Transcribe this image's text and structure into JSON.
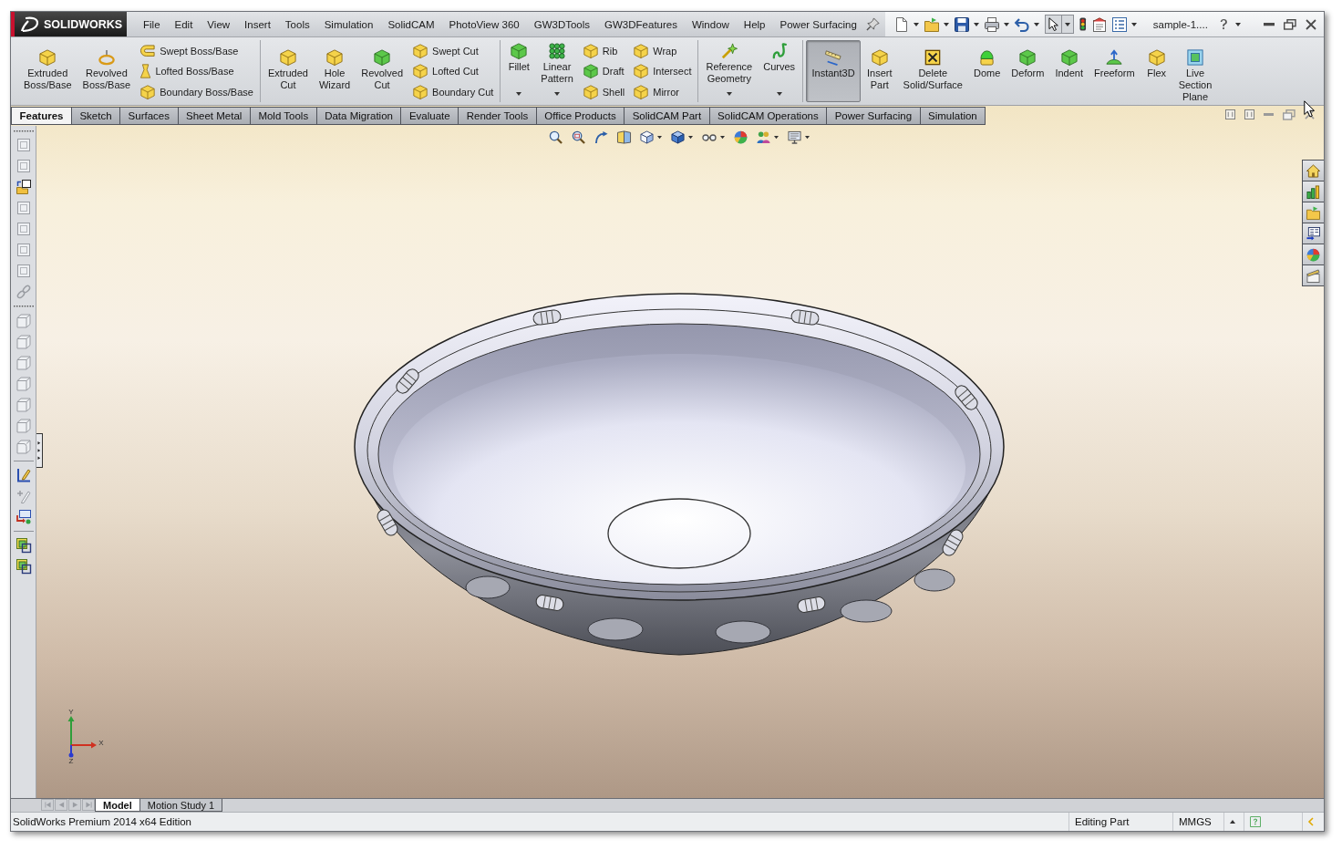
{
  "window": {
    "logo_text": "SOLIDWORKS"
  },
  "menu": [
    "File",
    "Edit",
    "View",
    "Insert",
    "Tools",
    "Simulation",
    "SolidCAM",
    "PhotoView 360",
    "GW3DTools",
    "GW3DFeatures",
    "Window",
    "Help",
    "Power Surfacing"
  ],
  "quick_access": {
    "document_name": "sample-1...."
  },
  "ribbon": {
    "groups": [
      {
        "items": [
          {
            "kind": "large",
            "label": "Extruded\nBoss/Base",
            "pressed": false,
            "dropdown": false
          },
          {
            "kind": "large",
            "label": "Revolved\nBoss/Base",
            "pressed": false,
            "dropdown": false
          },
          {
            "kind": "stack",
            "buttons": [
              "Swept Boss/Base",
              "Lofted Boss/Base",
              "Boundary Boss/Base"
            ]
          }
        ]
      },
      {
        "items": [
          {
            "kind": "large",
            "label": "Extruded\nCut",
            "pressed": false,
            "dropdown": false
          },
          {
            "kind": "large",
            "label": "Hole\nWizard",
            "pressed": false,
            "dropdown": false
          },
          {
            "kind": "large",
            "label": "Revolved\nCut",
            "pressed": false,
            "dropdown": false
          },
          {
            "kind": "stack",
            "buttons": [
              "Swept Cut",
              "Lofted Cut",
              "Boundary Cut"
            ]
          }
        ]
      },
      {
        "items": [
          {
            "kind": "large",
            "label": "Fillet",
            "pressed": false,
            "dropdown": true
          },
          {
            "kind": "large",
            "label": "Linear\nPattern",
            "pressed": false,
            "dropdown": true
          },
          {
            "kind": "stack",
            "buttons": [
              "Rib",
              "Draft",
              "Shell"
            ]
          },
          {
            "kind": "stack",
            "buttons": [
              "Wrap",
              "Intersect",
              "Mirror"
            ]
          }
        ]
      },
      {
        "items": [
          {
            "kind": "large",
            "label": "Reference\nGeometry",
            "pressed": false,
            "dropdown": true
          },
          {
            "kind": "large",
            "label": "Curves",
            "pressed": false,
            "dropdown": true
          }
        ]
      },
      {
        "items": [
          {
            "kind": "large",
            "label": "Instant3D",
            "pressed": true,
            "dropdown": false
          },
          {
            "kind": "large",
            "label": "Insert\nPart",
            "pressed": false,
            "dropdown": false
          },
          {
            "kind": "large",
            "label": "Delete\nSolid/Surface",
            "pressed": false,
            "dropdown": false
          },
          {
            "kind": "large",
            "label": "Dome",
            "pressed": false,
            "dropdown": false
          },
          {
            "kind": "large",
            "label": "Deform",
            "pressed": false,
            "dropdown": false
          },
          {
            "kind": "large",
            "label": "Indent",
            "pressed": false,
            "dropdown": false
          },
          {
            "kind": "large",
            "label": "Freeform",
            "pressed": false,
            "dropdown": false
          },
          {
            "kind": "large",
            "label": "Flex",
            "pressed": false,
            "dropdown": false
          },
          {
            "kind": "large",
            "label": "Live\nSection\nPlane",
            "pressed": false,
            "dropdown": false
          }
        ]
      }
    ]
  },
  "tabs": [
    {
      "label": "Features",
      "selected": true
    },
    {
      "label": "Sketch",
      "selected": false
    },
    {
      "label": "Surfaces",
      "selected": false
    },
    {
      "label": "Sheet Metal",
      "selected": false
    },
    {
      "label": "Mold Tools",
      "selected": false
    },
    {
      "label": "Data Migration",
      "selected": false
    },
    {
      "label": "Evaluate",
      "selected": false
    },
    {
      "label": "Render Tools",
      "selected": false
    },
    {
      "label": "Office Products",
      "selected": false
    },
    {
      "label": "SolidCAM Part",
      "selected": false
    },
    {
      "label": "SolidCAM Operations",
      "selected": false
    },
    {
      "label": "Power Surfacing",
      "selected": false
    },
    {
      "label": "Simulation",
      "selected": false
    }
  ],
  "triad": {
    "labels": [
      "Y",
      "X",
      "Z"
    ]
  },
  "bottom_tabs": [
    {
      "label": "Model",
      "selected": true
    },
    {
      "label": "Motion Study 1",
      "selected": false
    }
  ],
  "status_bar": {
    "edition": "SolidWorks Premium 2014 x64 Edition",
    "mode": "Editing Part",
    "units": "MMGS"
  }
}
